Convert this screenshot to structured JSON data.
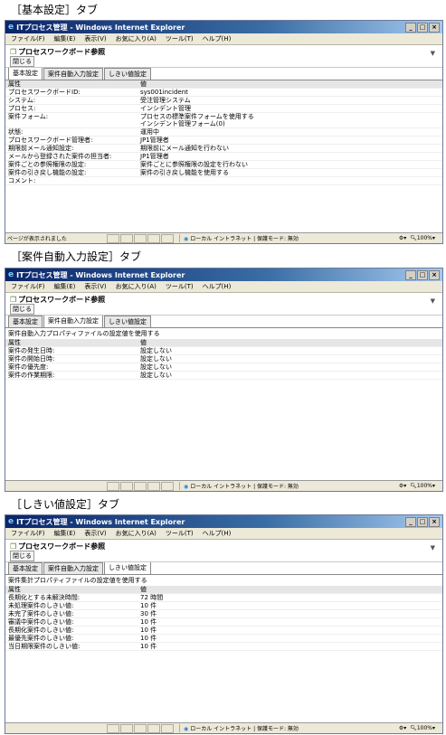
{
  "window_title": "ITプロセス管理 - Windows Internet Explorer",
  "menu": [
    "ファイル(F)",
    "編集(E)",
    "表示(V)",
    "お気に入り(A)",
    "ツール(T)",
    "ヘルプ(H)"
  ],
  "page_title": "プロセスワークボード参照",
  "close_label": "閉じる",
  "tabs": [
    "基本設定",
    "案件自動入力設定",
    "しきい値設定"
  ],
  "status": {
    "zone": "ローカル イントラネット | 保護モード: 無効",
    "zoom": "100%"
  },
  "sections": [
    {
      "caption": "［基本設定］タブ",
      "active_tab": 0,
      "status_text": "ページが表示されました",
      "notice": "",
      "header": [
        "属性",
        "値"
      ],
      "rows": [
        [
          "プロセスワークボードID:",
          "sys001incident"
        ],
        [
          "システム:",
          "受注管理システム"
        ],
        [
          "プロセス:",
          "インシデント管理"
        ],
        [
          "案件フォーム:",
          "プロセスの標準案件フォームを使用する\nインシデント管理フォーム(0)"
        ],
        [
          "状態:",
          "運用中"
        ],
        [
          "プロセスワークボード管理者:",
          "JP1管理者"
        ],
        [
          "期限前メール通知設定:",
          "期限前にメール通知を行わない"
        ],
        [
          "メールから登録された案件の担当者:",
          "JP1管理者"
        ],
        [
          "案件ごとの参照権限の設定:",
          "案件ごとに参照権限の設定を行わない"
        ],
        [
          "案件の引き戻し機能の設定:",
          "案件の引き戻し機能を使用する"
        ],
        [
          "コメント:",
          ""
        ]
      ]
    },
    {
      "caption": "［案件自動入力設定］タブ",
      "active_tab": 1,
      "status_text": "",
      "notice": "案件自動入力プロパティファイルの設定値を使用する",
      "header": [
        "属性",
        "値"
      ],
      "rows": [
        [
          "案件の発生日時:",
          "設定しない"
        ],
        [
          "案件の開始日時:",
          "設定しない"
        ],
        [
          "案件の優先度:",
          "設定しない"
        ],
        [
          "案件の作業期限:",
          "設定しない"
        ]
      ]
    },
    {
      "caption": "［しきい値設定］タブ",
      "active_tab": 2,
      "status_text": "",
      "notice": "案件集計プロパティファイルの設定値を使用する",
      "header": [
        "属性",
        "値"
      ],
      "rows": [
        [
          "長期化とする未解決時間:",
          "72 時間"
        ],
        [
          "未処理案件のしきい値:",
          "10 件"
        ],
        [
          "未完了案件のしきい値:",
          "30 件"
        ],
        [
          "審議中案件のしきい値:",
          "10 件"
        ],
        [
          "長期化案件のしきい値:",
          "10 件"
        ],
        [
          "最優先案件のしきい値:",
          "10 件"
        ],
        [
          "当日期限案件のしきい値:",
          "10 件"
        ]
      ]
    }
  ]
}
